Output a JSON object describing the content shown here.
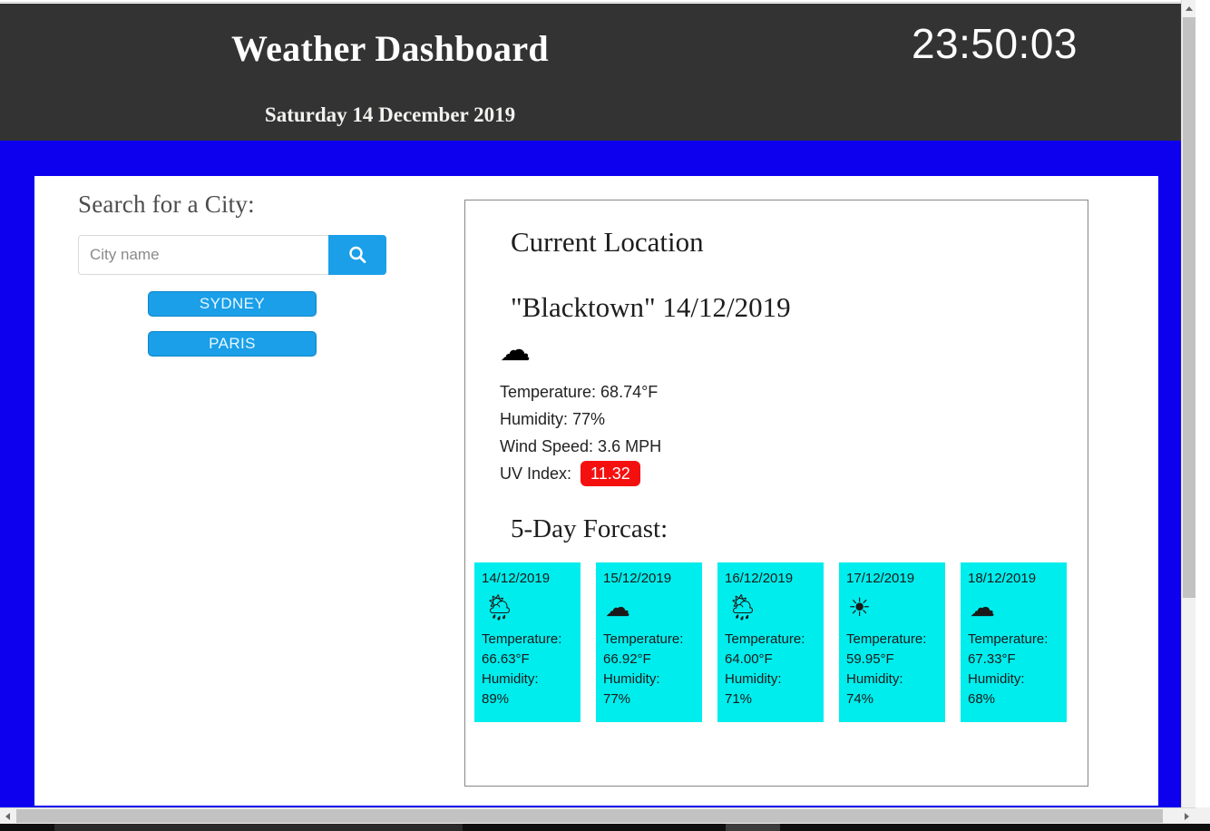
{
  "header": {
    "title": "Weather Dashboard",
    "date": "Saturday 14 December 2019",
    "clock": "23:50:03",
    "background_color": "#333333"
  },
  "page": {
    "background_color": "#0d00ee"
  },
  "sidebar": {
    "heading": "Search for a City:",
    "search": {
      "placeholder": "City name",
      "value": "",
      "button_icon": "search-icon"
    },
    "cities": [
      {
        "label": "SYDNEY"
      },
      {
        "label": "PARIS"
      }
    ],
    "button_color": "#1a9fe8"
  },
  "current": {
    "section_title": "Current Location",
    "headline": "\"Blacktown\" 14/12/2019",
    "icon": "☁",
    "icon_name": "cloud-icon",
    "temperature": "Temperature: 68.74°F",
    "humidity": "Humidity: 77%",
    "wind_speed": "Wind Speed: 3.6 MPH",
    "uv_label": "UV Index:",
    "uv_value": "11.32",
    "uv_color": "#f51010"
  },
  "forecast": {
    "title": "5-Day Forcast:",
    "card_color": "#00eded",
    "days": [
      {
        "date": "14/12/2019",
        "icon": "🌦",
        "icon_name": "rain-cloud-icon",
        "temperature_label": "Temperature:",
        "temperature_value": "66.63°F",
        "humidity_label": "Humidity:",
        "humidity_value": "89%"
      },
      {
        "date": "15/12/2019",
        "icon": "☁",
        "icon_name": "cloud-icon",
        "temperature_label": "Temperature:",
        "temperature_value": "66.92°F",
        "humidity_label": "Humidity:",
        "humidity_value": "77%"
      },
      {
        "date": "16/12/2019",
        "icon": "🌦",
        "icon_name": "rain-cloud-icon",
        "temperature_label": "Temperature:",
        "temperature_value": "64.00°F",
        "humidity_label": "Humidity:",
        "humidity_value": "71%"
      },
      {
        "date": "17/12/2019",
        "icon": "☀",
        "icon_name": "sun-icon",
        "temperature_label": "Temperature:",
        "temperature_value": "59.95°F",
        "humidity_label": "Humidity:",
        "humidity_value": "74%"
      },
      {
        "date": "18/12/2019",
        "icon": "☁",
        "icon_name": "cloud-icon",
        "temperature_label": "Temperature:",
        "temperature_value": "67.33°F",
        "humidity_label": "Humidity:",
        "humidity_value": "68%"
      }
    ]
  }
}
